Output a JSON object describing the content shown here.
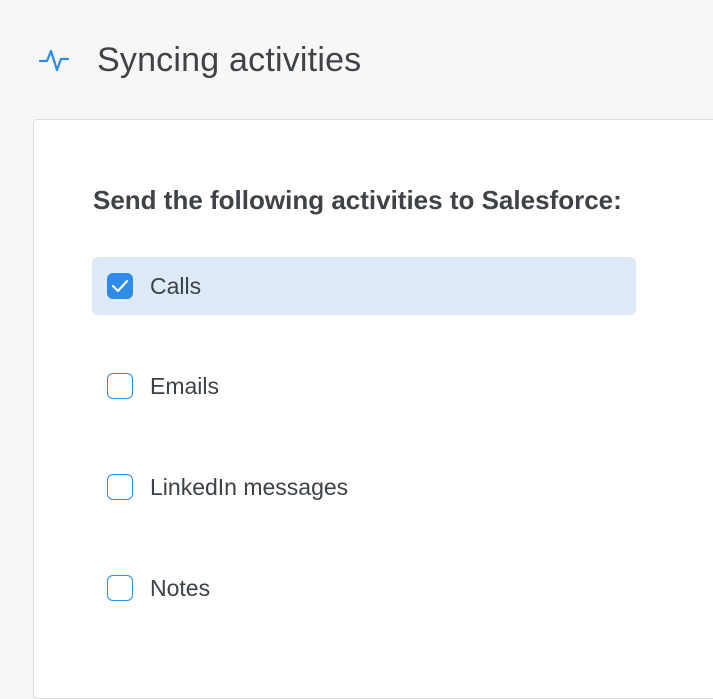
{
  "header": {
    "title": "Syncing activities",
    "icon": "activity-pulse-icon"
  },
  "card": {
    "heading": "Send the following activities to Salesforce:",
    "options": [
      {
        "label": "Calls",
        "checked": true
      },
      {
        "label": "Emails",
        "checked": false
      },
      {
        "label": "LinkedIn messages",
        "checked": false
      },
      {
        "label": "Notes",
        "checked": false
      }
    ]
  },
  "colors": {
    "accent": "#2e8be8",
    "selected_row": "#deeaf7",
    "text": "#3c4248"
  }
}
